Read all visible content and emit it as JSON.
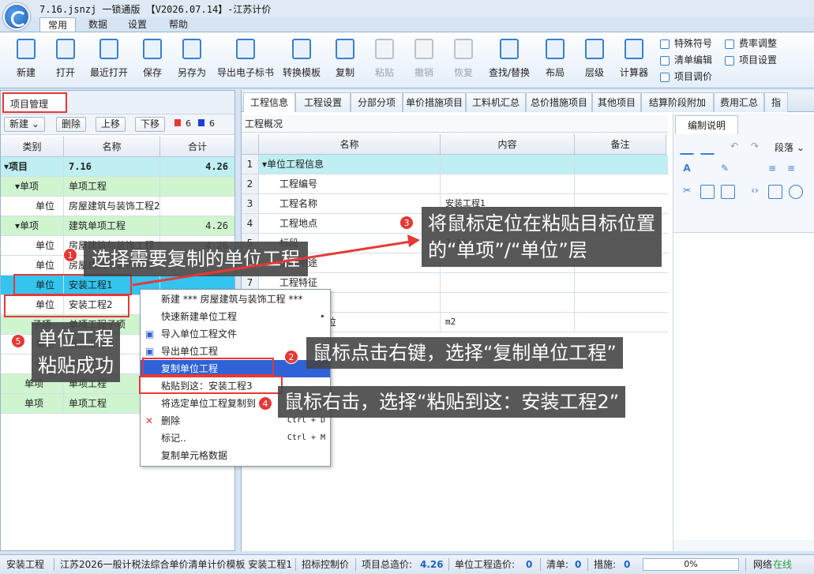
{
  "window": {
    "title": "7.16.jsnzj  一锁通版 【V2026.07.14】-江苏计价"
  },
  "menu": [
    "常用",
    "数据",
    "设置",
    "帮助"
  ],
  "ribbon": {
    "buttons": [
      "新建",
      "打开",
      "最近打开",
      "保存",
      "另存为",
      "导出电子标书",
      "转换模板",
      "复制",
      "粘贴",
      "撤销",
      "恢复",
      "查找/替换",
      "布局",
      "层级",
      "计算器"
    ],
    "small": [
      "特殊符号",
      "清单编辑",
      "项目调价",
      "费率调整",
      "项目设置"
    ]
  },
  "left": {
    "panel_title": "项目管理",
    "toolbar": {
      "new": "新建",
      "new_arrow": "⌄",
      "delete": "删除",
      "up": "上移",
      "down": "下移",
      "red_count": "6",
      "blue_count": "6"
    },
    "columns": [
      "类别",
      "名称",
      "合计"
    ],
    "rows": [
      {
        "cat": "▾项目",
        "name": "7.16",
        "total": "4.26"
      },
      {
        "cat": "▾单项",
        "name": "单项工程",
        "total": ""
      },
      {
        "cat": "单位",
        "name": "房屋建筑与装饰工程2",
        "total": ""
      },
      {
        "cat": "▾单项",
        "name": "建筑单项工程",
        "total": "4.26"
      },
      {
        "cat": "单位",
        "name": "房屋建筑与装饰工程",
        "total": "4.26"
      },
      {
        "cat": "单位",
        "name": "房屋建筑与装饰工程",
        "total": ""
      },
      {
        "cat": "单位",
        "name": "安装工程1",
        "total": ""
      },
      {
        "cat": "单位",
        "name": "安装工程2",
        "total": ""
      },
      {
        "cat": "子项",
        "name": "单项工程子项",
        "total": ""
      },
      {
        "cat": "单位",
        "name": "安装工程3",
        "total": ""
      },
      {
        "cat": "单位",
        "name": "安装工程1",
        "total": ""
      },
      {
        "cat": "单项",
        "name": "单项工程",
        "total": ""
      },
      {
        "cat": "单项",
        "name": "单项工程",
        "total": ""
      }
    ]
  },
  "tabs": [
    "工程信息",
    "工程设置",
    "分部分项",
    "单价措施项目",
    "工料机汇总",
    "总价措施项目",
    "其他项目",
    "结算阶段附加",
    "费用汇总",
    "指"
  ],
  "overview": {
    "title": "工程概况",
    "columns": [
      "名称",
      "内容",
      "备注"
    ],
    "rows": [
      {
        "n": "1",
        "name": "▾单位工程信息",
        "value": ""
      },
      {
        "n": "2",
        "name": "工程编号",
        "value": ""
      },
      {
        "n": "3",
        "name": "工程名称",
        "value": "安装工程1"
      },
      {
        "n": "4",
        "name": "工程地点",
        "value": ""
      },
      {
        "n": "5",
        "name": "标段",
        "value": "7.16"
      },
      {
        "n": "6",
        "name": "工程用途",
        "value": ""
      },
      {
        "n": "7",
        "name": "工程特征",
        "value": ""
      },
      {
        "n": "8",
        "name": "工程规模",
        "value": ""
      },
      {
        "n": "9",
        "name": "工程规模单位",
        "value": "m2"
      }
    ]
  },
  "notes": {
    "tab": "编制说明",
    "paragraph": "段落"
  },
  "context_menu": [
    {
      "label": "新建 *** 房屋建筑与装饰工程 ***",
      "shortcut": ""
    },
    {
      "label": "快速新建单位工程",
      "shortcut": "▸"
    },
    {
      "label": "导入单位工程文件",
      "shortcut": ""
    },
    {
      "label": "导出单位工程",
      "shortcut": ""
    },
    {
      "label": "复制单位工程",
      "shortcut": ""
    },
    {
      "label": "粘贴到这：安装工程3",
      "shortcut": ""
    },
    {
      "label": "将选定单位工程复制到",
      "shortcut": "▸"
    },
    {
      "label": "删除",
      "shortcut": "Ctrl + D"
    },
    {
      "label": "标记..",
      "shortcut": "Ctrl + M"
    },
    {
      "label": "复制单元格数据",
      "shortcut": ""
    }
  ],
  "callouts": {
    "c1": "选择需要复制的单位工程",
    "c2": "鼠标点击右键，选择“复制单位工程”",
    "c3a": "将鼠标定位在粘贴目标位置",
    "c3b": "的“单项”/“单位”层",
    "c4": "鼠标右击，选择“粘贴到这：安装工程2”",
    "c5a": "单位工程",
    "c5b": "粘贴成功",
    "b1": "1",
    "b2": "2",
    "b3": "3",
    "b4": "4",
    "b5": "5"
  },
  "status": {
    "project": "安装工程",
    "template": "江苏2026一般计税法综合单价清单计价模板 安装工程1",
    "control": "招标控制价",
    "total_label": "项目总造价:",
    "total": "4.26",
    "unit_label": "单位工程造价:",
    "unit": "0",
    "list_label": "清单:",
    "list": "0",
    "measure_label": "措施:",
    "measure": "0",
    "progress": "0%",
    "network_label": "网络",
    "network": "在线"
  }
}
